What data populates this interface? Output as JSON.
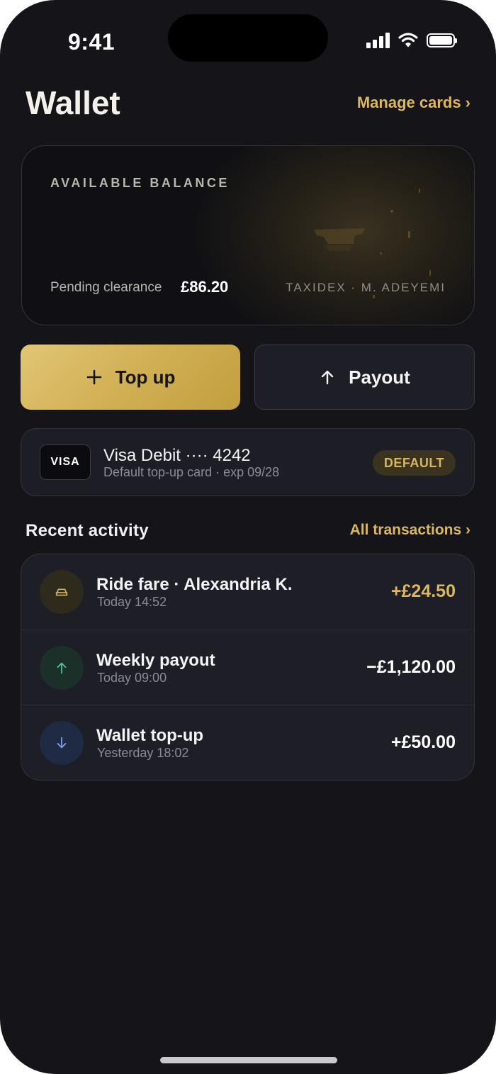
{
  "status_bar": {
    "time": "9:41"
  },
  "header": {
    "title": "Wallet",
    "manage_link": "Manage cards ›"
  },
  "balance_card": {
    "label": "AVAILABLE BALANCE",
    "pending_label": "Pending clearance",
    "pending_value": "£86.20",
    "holder": "TAXIDEX · M. ADEYEMI"
  },
  "actions": {
    "topup_label": "Top up",
    "payout_label": "Payout"
  },
  "payment_card": {
    "brand": "VISA",
    "name": "Visa Debit ···· 4242",
    "subtitle": "Default top-up card · exp 09/28",
    "badge": "DEFAULT"
  },
  "activity": {
    "title": "Recent activity",
    "all_link": "All transactions ›",
    "items": [
      {
        "title": "Ride fare · Alexandria K.",
        "time": "Today 14:52",
        "amount": "+£24.50",
        "icon": "car-icon",
        "amount_color": "#dcb761",
        "icon_bg": "#2e2a1c",
        "icon_color": "#d9b55c"
      },
      {
        "title": "Weekly payout",
        "time": "Today 09:00",
        "amount": "−£1,120.00",
        "icon": "arrow-up-icon",
        "amount_color": "#ffffff",
        "icon_bg": "#1b3029",
        "icon_color": "#4fc08d"
      },
      {
        "title": "Wallet top-up",
        "time": "Yesterday 18:02",
        "amount": "+£50.00",
        "icon": "arrow-down-icon",
        "amount_color": "#ffffff",
        "icon_bg": "#1f2a45",
        "icon_color": "#7d9be6"
      }
    ]
  },
  "colors": {
    "accent": "#dcb761",
    "background": "#141419",
    "surface": "#1e1e27"
  }
}
